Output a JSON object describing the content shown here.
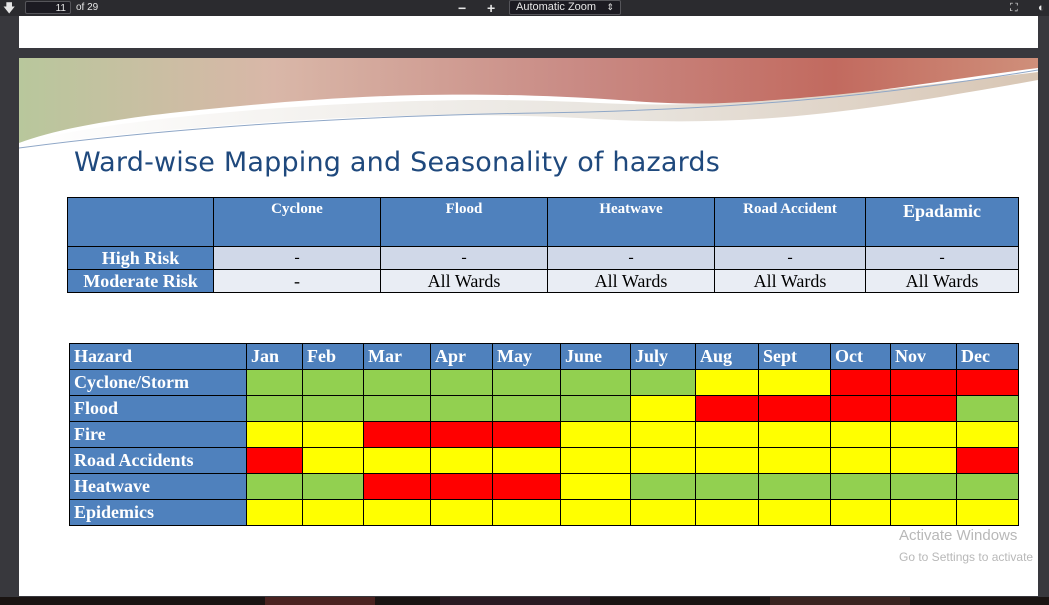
{
  "toolbar": {
    "page_number": "11",
    "page_total": "of 29",
    "zoom_out": "−",
    "zoom_in": "+",
    "zoom_label": "Automatic Zoom",
    "down_arrow": "🡇"
  },
  "slide": {
    "title": "Ward-wise Mapping and Seasonality of hazards",
    "risk_table": {
      "headers": [
        "Cyclone",
        "Flood",
        "Heatwave",
        "Road Accident",
        "Epadamic"
      ],
      "rows": [
        {
          "label": "High Risk",
          "values": [
            "-",
            "-",
            "-",
            "-",
            "-"
          ]
        },
        {
          "label": "Moderate Risk",
          "values": [
            "-",
            "All Wards",
            "All Wards",
            "All Wards",
            "All Wards"
          ]
        }
      ]
    },
    "seasonality_table": {
      "header_label": "Hazard",
      "months": [
        "Jan",
        "Feb",
        "Mar",
        "Apr",
        "May",
        "June",
        "July",
        "Aug",
        "Sept",
        "Oct",
        "Nov",
        "Dec"
      ],
      "legend_colors": {
        "G": "#92d050",
        "Y": "#ffff00",
        "R": "#ff0000"
      },
      "rows": [
        {
          "hazard": "Cyclone/Storm",
          "levels": [
            "G",
            "G",
            "G",
            "G",
            "G",
            "G",
            "G",
            "Y",
            "Y",
            "R",
            "R",
            "R"
          ]
        },
        {
          "hazard": "Flood",
          "levels": [
            "G",
            "G",
            "G",
            "G",
            "G",
            "G",
            "Y",
            "R",
            "R",
            "R",
            "R",
            "G"
          ]
        },
        {
          "hazard": "Fire",
          "levels": [
            "Y",
            "Y",
            "R",
            "R",
            "R",
            "Y",
            "Y",
            "Y",
            "Y",
            "Y",
            "Y",
            "Y"
          ]
        },
        {
          "hazard": "Road Accidents",
          "levels": [
            "R",
            "Y",
            "Y",
            "Y",
            "Y",
            "Y",
            "Y",
            "Y",
            "Y",
            "Y",
            "Y",
            "R"
          ]
        },
        {
          "hazard": "Heatwave",
          "levels": [
            "G",
            "G",
            "R",
            "R",
            "R",
            "Y",
            "G",
            "G",
            "G",
            "G",
            "G",
            "G"
          ]
        },
        {
          "hazard": "Epidemics",
          "levels": [
            "Y",
            "Y",
            "Y",
            "Y",
            "Y",
            "Y",
            "Y",
            "Y",
            "Y",
            "Y",
            "Y",
            "Y"
          ]
        }
      ]
    }
  },
  "watermark": {
    "line1": "Activate Windows",
    "line2": "Go to Settings to activate"
  }
}
